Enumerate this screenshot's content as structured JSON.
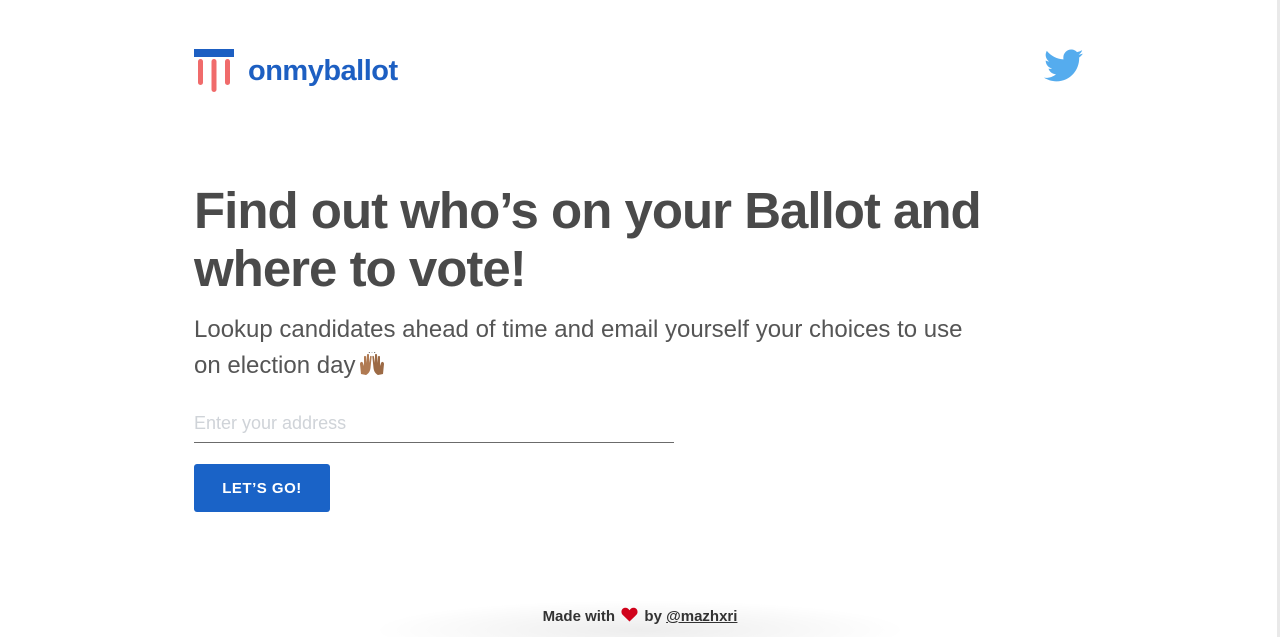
{
  "brand": {
    "name": "onmyballot",
    "logo_icon": "ballot-shield-icon",
    "colors": {
      "brand_blue": "#1d5fc2",
      "stripe_red": "#f06b6b",
      "twitter_blue": "#55acee"
    }
  },
  "header": {
    "twitter_icon": "twitter-bird-icon"
  },
  "hero": {
    "title": "Find out who’s on your Ballot and where to vote!",
    "subtitle": "Lookup candidates ahead of time and email yourself your choices to use on election day",
    "subtitle_emoji": "raised-hands-icon"
  },
  "form": {
    "address_placeholder": "Enter your address",
    "address_value": "",
    "submit_label": "LET’S GO!"
  },
  "footer": {
    "made_with": "Made with",
    "by": "by",
    "author": "@mazhxri",
    "heart_icon": "heart-icon"
  }
}
